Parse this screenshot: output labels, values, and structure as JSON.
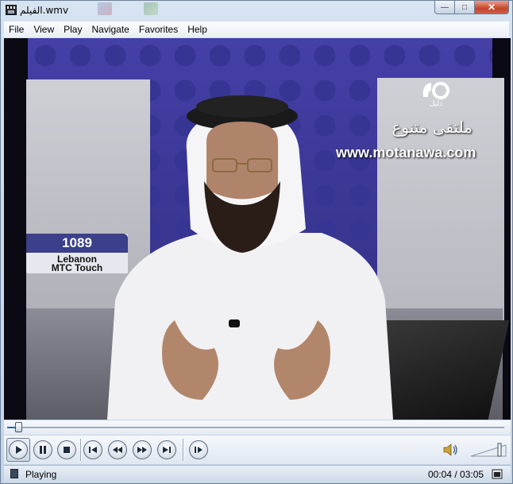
{
  "window": {
    "title": "الفيلم.wmv",
    "buttons": {
      "minimize": "—",
      "maximize": "□",
      "close": "✕"
    }
  },
  "menu": [
    "File",
    "View",
    "Play",
    "Navigate",
    "Favorites",
    "Help"
  ],
  "video": {
    "overlay_arabic": "ملتقى متنوع",
    "overlay_url": "www.motanawa.com",
    "channel_logo_text": "دليل",
    "phone_number": "1089",
    "phone_label_line1": "Lebanon",
    "phone_label_line2": "MTC Touch"
  },
  "playback": {
    "progress_fraction": 0.022,
    "controls": [
      "play",
      "pause",
      "stop",
      "previous",
      "rewind",
      "fast-forward",
      "next",
      "switch-to-skin"
    ]
  },
  "status": {
    "state": "Playing",
    "time": "00:04 / 03:05"
  },
  "volume": {
    "level_fraction": 0.85
  }
}
